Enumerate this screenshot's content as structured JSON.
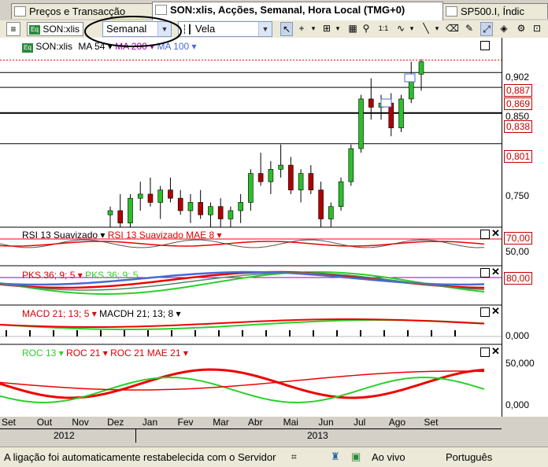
{
  "tabs": [
    {
      "label": "Preços e Transacção"
    },
    {
      "label": "SON:xlis, Acções, Semanal, Hora Local (TMG+0)"
    },
    {
      "label": "SP500.I, Índic"
    }
  ],
  "toolbar": {
    "symbol": "SON:xlis",
    "period": "Semanal",
    "chart_type": "Vela"
  },
  "main_legend": {
    "symbol": "SON:xlis",
    "ma1": "MA 54",
    "ma2": "MA 200",
    "ma3": "MA 100"
  },
  "price_labels": {
    "p902": "0,902",
    "p887": "0,887",
    "p869": "0,869",
    "p850": "0,850",
    "p838": "0,838",
    "p801": "0,801",
    "p750": "0,750"
  },
  "rsi": {
    "legend1": "RSI 13 Suavizado",
    "legend2": "RSI 13 Suavizado MAE 8",
    "l70": "70,00",
    "l50": "50,00"
  },
  "pks": {
    "legend1": "PKS 36; 9; 5",
    "legend2": "PKS 36; 9; 5",
    "l80": "80,00"
  },
  "macd": {
    "legend1": "MACD 21; 13; 5",
    "legend2": "MACDH 21; 13; 8",
    "l0": "0,000"
  },
  "roc": {
    "legend1": "ROC 13",
    "legend2": "ROC 21",
    "legend3": "ROC 21 MAE 21",
    "l50000": "50,000",
    "l0": "0,000"
  },
  "x_axis": {
    "months": [
      "Set",
      "Out",
      "Nov",
      "Dez",
      "Jan",
      "Fev",
      "Mar",
      "Abr",
      "Mai",
      "Jun",
      "Jul",
      "Ago",
      "Set"
    ],
    "years": [
      "2012",
      "2013"
    ]
  },
  "status": {
    "message": "A ligação foi automaticamente restabelecida com o Servidor",
    "live": "Ao vivo",
    "language": "Português"
  },
  "chart_data": {
    "type": "line",
    "candles": [
      {
        "o": 0.715,
        "h": 0.725,
        "l": 0.7,
        "c": 0.72
      },
      {
        "o": 0.72,
        "h": 0.74,
        "l": 0.7,
        "c": 0.705
      },
      {
        "o": 0.705,
        "h": 0.74,
        "l": 0.7,
        "c": 0.735
      },
      {
        "o": 0.735,
        "h": 0.755,
        "l": 0.72,
        "c": 0.74
      },
      {
        "o": 0.74,
        "h": 0.76,
        "l": 0.725,
        "c": 0.73
      },
      {
        "o": 0.73,
        "h": 0.75,
        "l": 0.71,
        "c": 0.745
      },
      {
        "o": 0.745,
        "h": 0.76,
        "l": 0.73,
        "c": 0.735
      },
      {
        "o": 0.735,
        "h": 0.745,
        "l": 0.715,
        "c": 0.72
      },
      {
        "o": 0.72,
        "h": 0.74,
        "l": 0.705,
        "c": 0.73
      },
      {
        "o": 0.73,
        "h": 0.745,
        "l": 0.71,
        "c": 0.715
      },
      {
        "o": 0.715,
        "h": 0.73,
        "l": 0.7,
        "c": 0.725
      },
      {
        "o": 0.725,
        "h": 0.735,
        "l": 0.7,
        "c": 0.71
      },
      {
        "o": 0.71,
        "h": 0.725,
        "l": 0.7,
        "c": 0.72
      },
      {
        "o": 0.72,
        "h": 0.74,
        "l": 0.705,
        "c": 0.73
      },
      {
        "o": 0.73,
        "h": 0.77,
        "l": 0.72,
        "c": 0.765
      },
      {
        "o": 0.765,
        "h": 0.79,
        "l": 0.75,
        "c": 0.755
      },
      {
        "o": 0.755,
        "h": 0.78,
        "l": 0.74,
        "c": 0.77
      },
      {
        "o": 0.77,
        "h": 0.8,
        "l": 0.76,
        "c": 0.775
      },
      {
        "o": 0.775,
        "h": 0.785,
        "l": 0.74,
        "c": 0.745
      },
      {
        "o": 0.745,
        "h": 0.77,
        "l": 0.73,
        "c": 0.765
      },
      {
        "o": 0.765,
        "h": 0.775,
        "l": 0.74,
        "c": 0.745
      },
      {
        "o": 0.745,
        "h": 0.755,
        "l": 0.7,
        "c": 0.71
      },
      {
        "o": 0.71,
        "h": 0.73,
        "l": 0.69,
        "c": 0.725
      },
      {
        "o": 0.725,
        "h": 0.76,
        "l": 0.72,
        "c": 0.755
      },
      {
        "o": 0.755,
        "h": 0.8,
        "l": 0.75,
        "c": 0.795
      },
      {
        "o": 0.795,
        "h": 0.86,
        "l": 0.79,
        "c": 0.855
      },
      {
        "o": 0.855,
        "h": 0.88,
        "l": 0.83,
        "c": 0.845
      },
      {
        "o": 0.845,
        "h": 0.86,
        "l": 0.83,
        "c": 0.85
      },
      {
        "o": 0.85,
        "h": 0.862,
        "l": 0.81,
        "c": 0.82
      },
      {
        "o": 0.82,
        "h": 0.86,
        "l": 0.815,
        "c": 0.855
      },
      {
        "o": 0.855,
        "h": 0.9,
        "l": 0.85,
        "c": 0.885
      },
      {
        "o": 0.885,
        "h": 0.903,
        "l": 0.865,
        "c": 0.9
      }
    ],
    "price_range": [
      0.7,
      0.91
    ]
  }
}
